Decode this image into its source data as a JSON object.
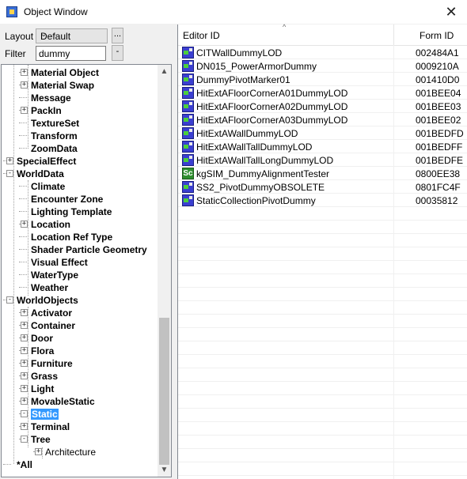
{
  "window": {
    "title": "Object Window",
    "close_glyph": "✕"
  },
  "controls": {
    "layout_label": "Layout",
    "layout_value": "Default",
    "layout_more": "...",
    "filter_label": "Filter",
    "filter_value": "dummy",
    "filter_more": "-"
  },
  "tree": {
    "rows": [
      {
        "label": "Material Object",
        "expander": "+",
        "bold": true
      },
      {
        "label": "Material Swap",
        "expander": "+",
        "bold": true
      },
      {
        "label": "Message",
        "expander": "",
        "bold": true
      },
      {
        "label": "PackIn",
        "expander": "+",
        "bold": true
      },
      {
        "label": "TextureSet",
        "expander": "",
        "bold": true
      },
      {
        "label": "Transform",
        "expander": "",
        "bold": true
      },
      {
        "label": "ZoomData",
        "expander": "",
        "bold": true
      },
      {
        "label": "SpecialEffect",
        "expander": "+",
        "bold": true
      },
      {
        "label": "WorldData",
        "expander": "-",
        "bold": true
      },
      {
        "label": "Climate",
        "expander": "",
        "bold": true
      },
      {
        "label": "Encounter Zone",
        "expander": "",
        "bold": true
      },
      {
        "label": "Lighting Template",
        "expander": "",
        "bold": true
      },
      {
        "label": "Location",
        "expander": "+",
        "bold": true
      },
      {
        "label": "Location Ref Type",
        "expander": "",
        "bold": true
      },
      {
        "label": "Shader Particle Geometry",
        "expander": "",
        "bold": true
      },
      {
        "label": "Visual Effect",
        "expander": "",
        "bold": true
      },
      {
        "label": "WaterType",
        "expander": "",
        "bold": true
      },
      {
        "label": "Weather",
        "expander": "",
        "bold": true
      },
      {
        "label": "WorldObjects",
        "expander": "-",
        "bold": true
      },
      {
        "label": "Activator",
        "expander": "+",
        "bold": true
      },
      {
        "label": "Container",
        "expander": "+",
        "bold": true
      },
      {
        "label": "Door",
        "expander": "+",
        "bold": true
      },
      {
        "label": "Flora",
        "expander": "+",
        "bold": true
      },
      {
        "label": "Furniture",
        "expander": "+",
        "bold": true
      },
      {
        "label": "Grass",
        "expander": "+",
        "bold": true
      },
      {
        "label": "Light",
        "expander": "+",
        "bold": true
      },
      {
        "label": "MovableStatic",
        "expander": "+",
        "bold": true
      },
      {
        "label": "Static",
        "expander": "-",
        "bold": true,
        "selected": true
      },
      {
        "label": "Terminal",
        "expander": "+",
        "bold": true
      },
      {
        "label": "Tree",
        "expander": "-",
        "bold": true
      },
      {
        "label": "Architecture",
        "expander": "+",
        "bold": false
      },
      {
        "label": "*All",
        "expander": "",
        "bold": true
      }
    ]
  },
  "list": {
    "columns": [
      "Editor ID",
      "Form ID"
    ],
    "sort_glyph": "^",
    "rows": [
      {
        "icon": "static-object-icon",
        "editor_id": "CITWallDummyLOD",
        "form_id": "002484A1"
      },
      {
        "icon": "static-object-icon",
        "editor_id": "DN015_PowerArmorDummy",
        "form_id": "0009210A"
      },
      {
        "icon": "static-object-icon",
        "editor_id": "DummyPivotMarker01",
        "form_id": "001410D0"
      },
      {
        "icon": "static-object-icon",
        "editor_id": "HitExtAFloorCornerA01DummyLOD",
        "form_id": "001BEE04"
      },
      {
        "icon": "static-object-icon",
        "editor_id": "HitExtAFloorCornerA02DummyLOD",
        "form_id": "001BEE03"
      },
      {
        "icon": "static-object-icon",
        "editor_id": "HitExtAFloorCornerA03DummyLOD",
        "form_id": "001BEE02"
      },
      {
        "icon": "static-object-icon",
        "editor_id": "HitExtAWallDummyLOD",
        "form_id": "001BEDFD"
      },
      {
        "icon": "static-object-icon",
        "editor_id": "HitExtAWallTallDummyLOD",
        "form_id": "001BEDFF"
      },
      {
        "icon": "static-object-icon",
        "editor_id": "HitExtAWallTallLongDummyLOD",
        "form_id": "001BEDFE"
      },
      {
        "icon": "script-icon",
        "icon_text": "Sc",
        "editor_id": "kgSIM_DummyAlignmentTester",
        "form_id": "0800EE38"
      },
      {
        "icon": "static-object-icon",
        "editor_id": "SS2_PivotDummyOBSOLETE",
        "form_id": "0801FC4F"
      },
      {
        "icon": "static-object-icon",
        "editor_id": "StaticCollectionPivotDummy",
        "form_id": "00035812"
      }
    ]
  },
  "scrollbar": {
    "up_glyph": "▲",
    "down_glyph": "▼"
  },
  "colors": {
    "selection": "#3399ff",
    "static_icon": "#3b3fd1",
    "script_icon": "#2f8f2f"
  }
}
